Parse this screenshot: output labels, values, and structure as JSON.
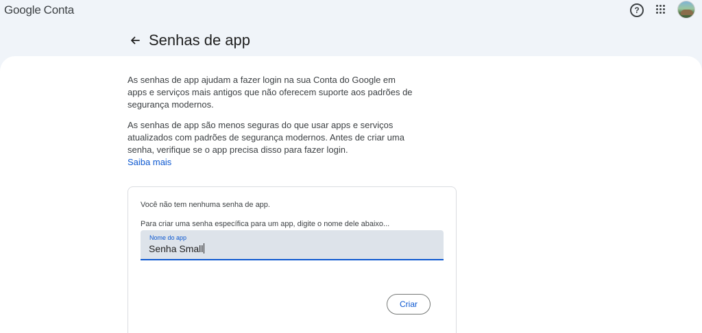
{
  "header": {
    "brand_google": "Google",
    "brand_conta": "Conta",
    "help_icon_glyph": "?",
    "apps_icon": "apps-grid-icon",
    "avatar_icon": "profile-avatar"
  },
  "page": {
    "title": "Senhas de app",
    "back_icon": "arrow-left-icon"
  },
  "intro": {
    "paragraph1": "As senhas de app ajudam a fazer login na sua Conta do Google em apps e serviços mais antigos que não oferecem suporte aos padrões de segurança modernos.",
    "paragraph2": "As senhas de app são menos seguras do que usar apps e serviços atualizados com padrões de segurança modernos. Antes de criar uma senha, verifique se o app precisa disso para fazer login.",
    "learn_more": "Saiba mais"
  },
  "card": {
    "empty_message": "Você não tem nenhuma senha de app.",
    "instructions": "Para criar uma senha específica para um app, digite o nome dele abaixo...",
    "input_label": "Nome do app",
    "input_value": "Senha Small",
    "create_button": "Criar"
  },
  "colors": {
    "accent": "#0b57d0",
    "background": "#f0f4f9",
    "field_bg": "#dde3ea"
  }
}
